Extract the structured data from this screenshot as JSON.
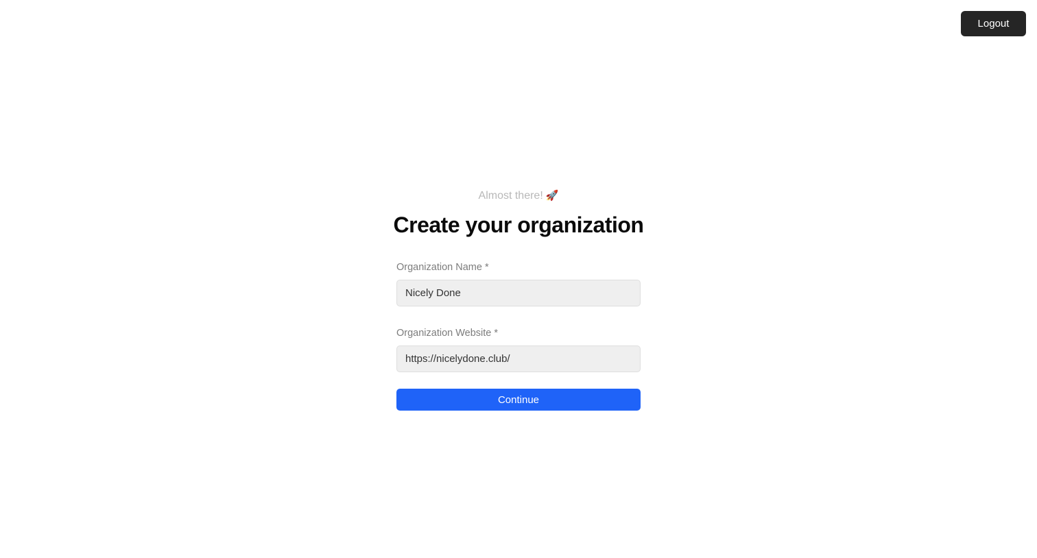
{
  "header": {
    "logout_label": "Logout"
  },
  "onboarding": {
    "eyebrow": "Almost there!",
    "eyebrow_icon": "🚀",
    "title": "Create your organization"
  },
  "form": {
    "org_name": {
      "label": "Organization Name *",
      "value": "Nicely Done"
    },
    "org_website": {
      "label": "Organization Website *",
      "value": "https://nicelydone.club/"
    },
    "continue_label": "Continue"
  },
  "colors": {
    "primary": "#1f63f8",
    "logout_bg": "#252525",
    "input_bg": "#efefef"
  }
}
